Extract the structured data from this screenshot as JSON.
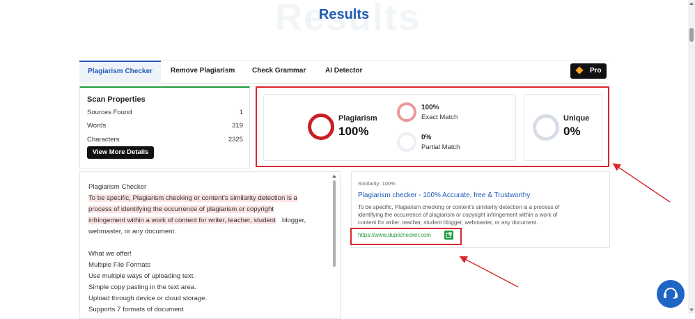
{
  "header": {
    "ghost": "Results",
    "title": "Results"
  },
  "tabs": [
    {
      "label": "Plagiarism Checker"
    },
    {
      "label": "Remove Plagiarism"
    },
    {
      "label": "Check Grammar"
    },
    {
      "label": "AI Detector"
    }
  ],
  "pro": {
    "label": "Pro"
  },
  "scan": {
    "title": "Scan Properties",
    "rows": [
      {
        "label": "Sources Found",
        "value": "1"
      },
      {
        "label": "Words",
        "value": "319"
      },
      {
        "label": "Characters",
        "value": "2325"
      }
    ],
    "button": "View More Details"
  },
  "results": {
    "plagiarism": {
      "label": "Plagiarism",
      "value": "100%"
    },
    "exact": {
      "value": "100%",
      "label": "Exact Match"
    },
    "partial": {
      "value": "0%",
      "label": "Partial Match"
    },
    "unique": {
      "label": "Unique",
      "value": "0%"
    }
  },
  "text": {
    "lines": [
      "Plagiarism Checker",
      "To be specific, Plagiarism checking or content's similarity detection is a",
      "process of identifying the occurrence of plagiarism or copyright",
      "infringement within a work of content for writer, teacher, student",
      " blogger,",
      "webmaster, or any document.",
      "What we offer!",
      " Multiple File Formats",
      "Use multiple ways of uploading text.",
      "Simple copy pasting in the text area.",
      "Upload through device or cloud storage.",
      "Supports 7 formats of document"
    ]
  },
  "source": {
    "similarity": "Similarity: 100%",
    "title": "Plagiarism checker - 100% Accurate, free & Trustworthy",
    "lines": [
      "To be specific, Plagiarism checking or content's similarity detection is a process of",
      "identifying the occurrence of plagiarism or copyright infringement within a work of",
      "content for writer, teacher, student blogger, webmaster, or any document."
    ],
    "url": "https://www.duplichecker.com"
  },
  "colors": {
    "accent": "#1f5bb6",
    "danger": "#d9262b",
    "success": "#1f9b3c"
  },
  "icons": [
    "gem-icon",
    "external-link-icon",
    "chat-icon"
  ]
}
